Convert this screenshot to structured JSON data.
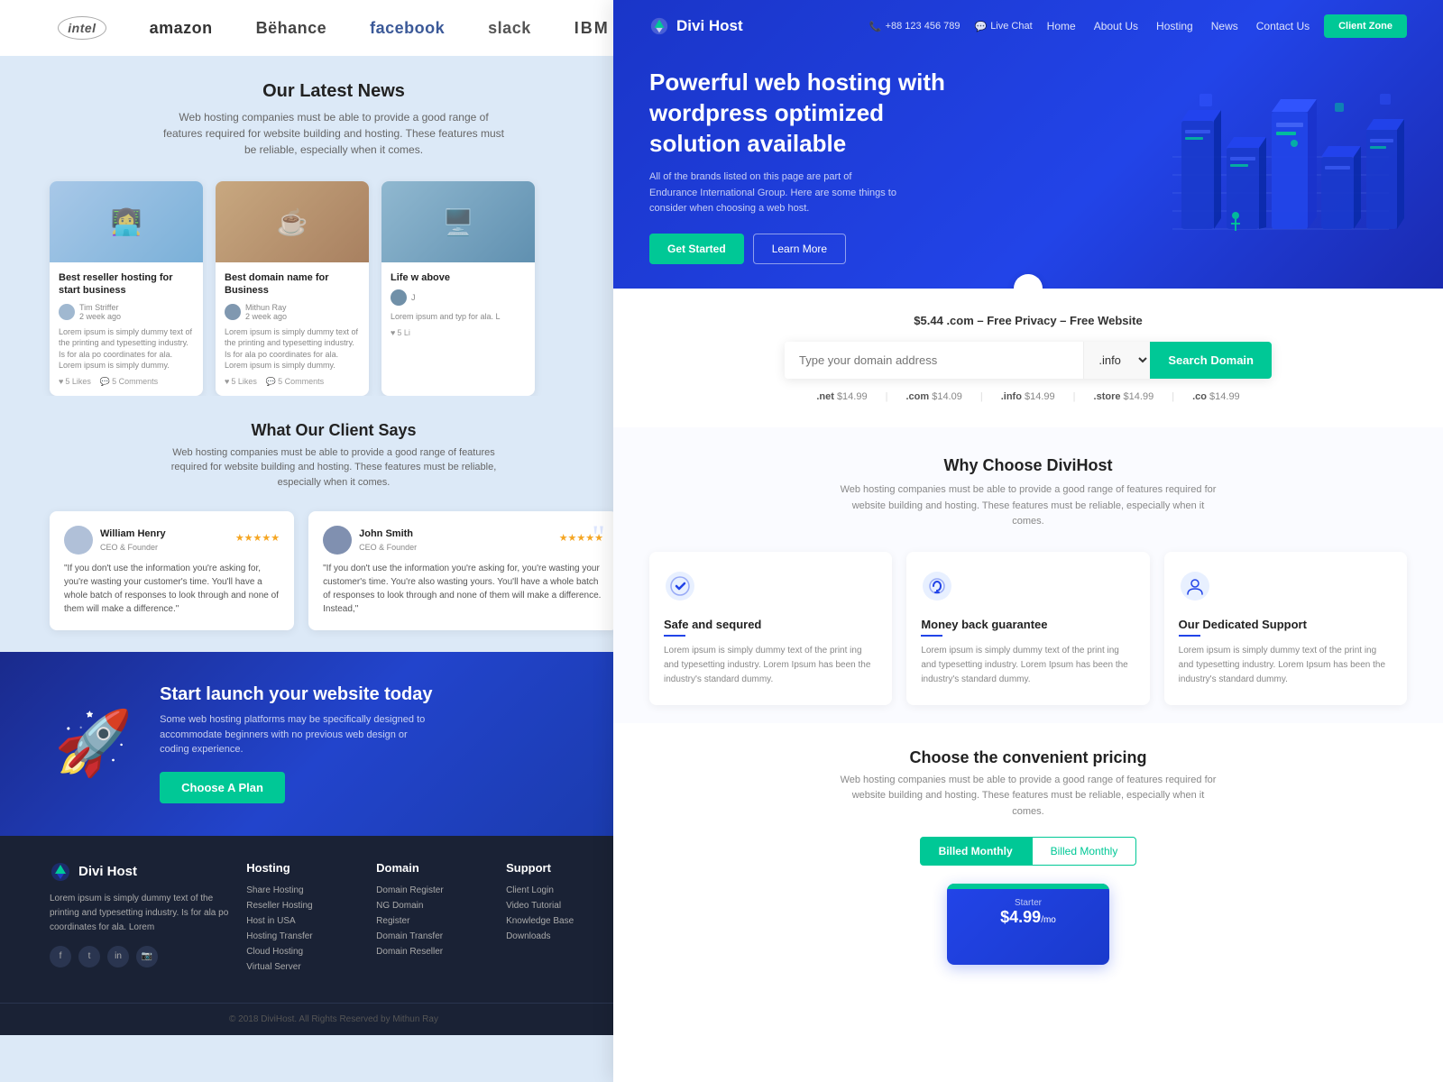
{
  "left": {
    "brands": [
      {
        "name": "intel",
        "label": "intel",
        "class": "intel"
      },
      {
        "name": "amazon",
        "label": "amazon",
        "class": "amazon"
      },
      {
        "name": "behance",
        "label": "Bëhance",
        "class": "behance"
      },
      {
        "name": "facebook",
        "label": "facebook",
        "class": "facebook"
      },
      {
        "name": "slack",
        "label": "slack",
        "class": "slack"
      },
      {
        "name": "ibm",
        "label": "IBM",
        "class": "ibm"
      }
    ],
    "news": {
      "title": "Our Latest News",
      "subtitle": "Web hosting companies must be able to provide a good range of features required for website building and hosting. These features must be reliable, especially when it comes.",
      "cards": [
        {
          "imgClass": "img1",
          "title": "Best reseller hosting for start business",
          "author": "Tim Striffer",
          "date": "2 week ago",
          "text": "Lorem ipsum is simply dummy text of the printing and typesetting industry. Is for ala po coordinates for ala. Lorem ipsum is simply dummy.",
          "likes": "5 Likes",
          "comments": "5 Comments"
        },
        {
          "imgClass": "img2",
          "title": "Best domain name for Business",
          "author": "Mithun Ray",
          "date": "2 week ago",
          "text": "Lorem ipsum is simply dummy text of the printing and typesetting industry. Is for ala po coordinates for ala. Lorem ipsum is simply dummy.",
          "likes": "5 Likes",
          "comments": "5 Comments"
        },
        {
          "imgClass": "img3",
          "title": "Life w above",
          "author": "J",
          "date": "",
          "text": "Lorem ipsum and typ for ala. L",
          "likes": "5 Li",
          "comments": ""
        }
      ]
    },
    "clients": {
      "title": "What Our Client Says",
      "subtitle": "Web hosting companies must be able to provide a good range of features required for website building and hosting. These features must be reliable, especially when it comes."
    },
    "testimonials": [
      {
        "name": "William Henry",
        "role": "CEO & Founder",
        "stars": "★★★★★",
        "text": "\"If you don't use the information you're asking for, you're wasting your customer's time. You'll have a whole batch of responses to look through and none of them will make a difference.\"",
        "featured": false
      },
      {
        "name": "John Smith",
        "role": "CEO & Founder",
        "stars": "★★★★★",
        "text": "\"If you don't use the information you're asking for, you're wasting your customer's time. You're also wasting yours. You'll have a whole batch of responses to look through and none of them will make a difference. Instead,\"",
        "featured": true
      }
    ],
    "cta": {
      "title": "Start launch your website today",
      "subtitle": "Some web hosting platforms may be specifically designed to accommodate beginners with no previous web design or coding experience.",
      "btnLabel": "Choose A Plan"
    },
    "footer": {
      "brand": "Divi Host",
      "desc": "Lorem ipsum is simply dummy text of the printing and typesetting industry. Is for ala po coordinates for ala. Lorem",
      "columns": [
        {
          "title": "Hosting",
          "links": [
            "Share Hosting",
            "Reseller Hosting",
            "Host in USA",
            "Hosting Transfer",
            "Cloud Hosting",
            "Virtual Server"
          ]
        },
        {
          "title": "Domain",
          "links": [
            "Domain Register",
            "NG Domain",
            "Register",
            "Domain Transfer",
            "Domain Reseller"
          ]
        },
        {
          "title": "Support",
          "links": [
            "Client Login",
            "Video Tutorial",
            "Knowledge Base",
            "Downloads"
          ]
        }
      ],
      "copyright": "© 2018 DiviHost. All Rights Reserved by Mithun Ray"
    }
  },
  "right": {
    "nav": {
      "brand": "Divi Host",
      "phone": "+88 123 456 789",
      "livechat": "Live Chat",
      "links": [
        "Home",
        "About Us",
        "Hosting",
        "News",
        "Contact Us"
      ],
      "ctaBtn": "Client Zone"
    },
    "hero": {
      "title": "Powerful web hosting with wordpress optimized solution available",
      "desc": "All of the brands listed on this page are part of Endurance International Group. Here are some things to consider when choosing a web host.",
      "btnPrimary": "Get Started",
      "btnSecondary": "Learn More"
    },
    "domain": {
      "promo": "$5.44 .com – Free Privacy – Free Website",
      "inputPlaceholder": "Type your domain address",
      "extLabel": ".info",
      "searchBtn": "Search Domain",
      "tlds": [
        {
          "ext": ".net",
          "price": "$14.99"
        },
        {
          "ext": ".com",
          "price": "$14.09"
        },
        {
          "ext": ".info",
          "price": "$14.99"
        },
        {
          "ext": ".store",
          "price": "$14.99"
        },
        {
          "ext": ".co",
          "price": "$14.99"
        }
      ]
    },
    "why": {
      "title": "Why Choose DiviHost",
      "subtitle": "Web hosting companies must be able to provide a good range of features required for website building and hosting. These features must be reliable, especially when it comes.",
      "cards": [
        {
          "icon": "⚙",
          "title": "Safe and sequred",
          "text": "Lorem ipsum is simply dummy text of the print ing and typesetting industry. Lorem Ipsum has been the industry's standard dummy."
        },
        {
          "icon": "💰",
          "title": "Money back guarantee",
          "text": "Lorem ipsum is simply dummy text of the print ing and typesetting industry. Lorem Ipsum has been the industry's standard dummy."
        },
        {
          "icon": "👤",
          "title": "Our Dedicated Support",
          "text": "Lorem ipsum is simply dummy text of the print ing and typesetting industry. Lorem Ipsum has been the industry's standard dummy."
        }
      ]
    },
    "pricing": {
      "title": "Choose the convenient pricing",
      "subtitle": "Web hosting companies must be able to provide a good range of features required for website building and hosting. These features must be reliable, especially when it comes.",
      "tabs": [
        "Billed Monthly",
        "Billed Monthly"
      ]
    }
  }
}
